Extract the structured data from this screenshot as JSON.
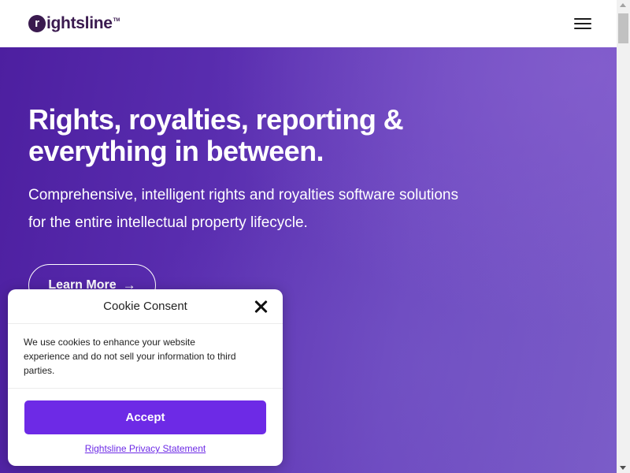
{
  "header": {
    "logo_mark": "r",
    "logo_text": "ightsline",
    "logo_tm": "TM",
    "menu_icon": "hamburger-menu-icon"
  },
  "hero": {
    "heading": "Rights, royalties, reporting & everything in between.",
    "subheading": "Comprehensive, intelligent rights and royalties software solutions for the entire intellectual property lifecycle.",
    "cta_label": "Learn More",
    "cta_icon": "arrow-right-icon",
    "cta_arrow": "→"
  },
  "cookie": {
    "title": "Cookie Consent",
    "message": "We use cookies to enhance your website experience and do not sell your information to third parties.",
    "accept_label": "Accept",
    "privacy_label": "Rightsline Privacy Statement",
    "close_icon": "close-icon"
  },
  "colors": {
    "brand_dark": "#3a1a4f",
    "accent": "#6d2ae6",
    "hero_start": "#4d1fa0",
    "hero_end": "#7b5cc8"
  }
}
